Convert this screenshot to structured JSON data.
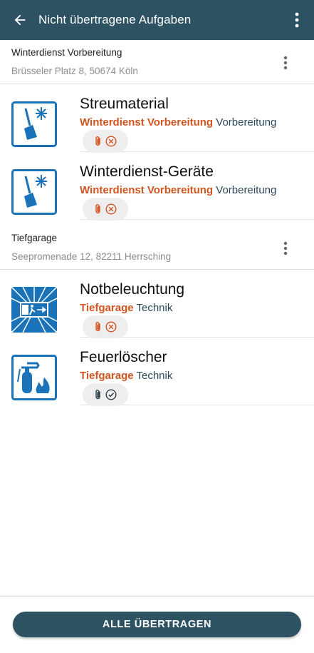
{
  "appbar": {
    "title": "Nicht übertragene Aufgaben",
    "back_icon": "arrow-left-icon",
    "menu_icon": "more-vert-icon",
    "color": "#2d5261"
  },
  "groups": [
    {
      "name": "Winterdienst Vorbereitung",
      "address": "Brüsseler Platz 8, 50674 Köln",
      "tasks": [
        {
          "title": "Streumaterial",
          "location": "Winterdienst Vorbereitung",
          "category": "Vorbereitung",
          "icon": "snow-shovel-icon",
          "status": "error"
        },
        {
          "title": "Winterdienst-Geräte",
          "location": "Winterdienst Vorbereitung",
          "category": "Vorbereitung",
          "icon": "snow-shovel-icon",
          "status": "error"
        }
      ]
    },
    {
      "name": "Tiefgarage",
      "address": "Seepromenade 12, 82211 Herrsching",
      "tasks": [
        {
          "title": "Notbeleuchtung",
          "location": "Tiefgarage",
          "category": "Technik",
          "icon": "emergency-exit-icon",
          "status": "error"
        },
        {
          "title": "Feuerlöscher",
          "location": "Tiefgarage",
          "category": "Technik",
          "icon": "fire-extinguisher-icon",
          "status": "ok"
        }
      ]
    }
  ],
  "footer": {
    "button_label": "ALLE ÜBERTRAGEN"
  },
  "colors": {
    "accent": "#2d5261",
    "location": "#d4541f",
    "category": "#2c4a57",
    "icon_blue": "#1a73b8",
    "error": "#d4541f"
  }
}
